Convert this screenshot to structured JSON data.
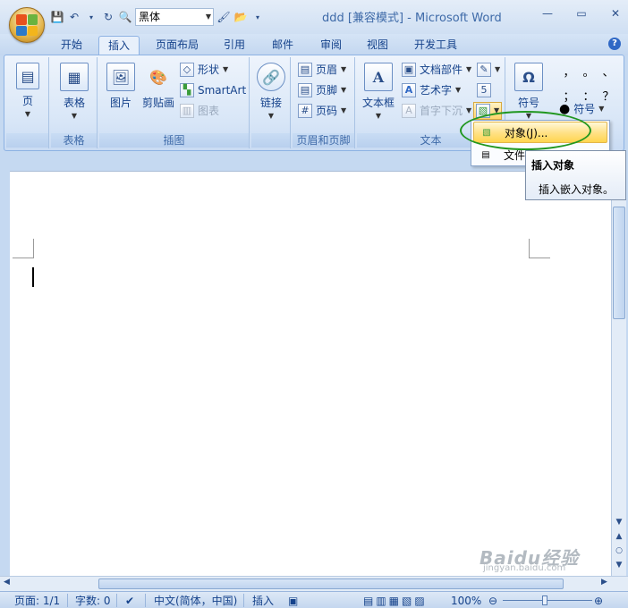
{
  "window": {
    "title": "ddd [兼容模式] - Microsoft Word",
    "controls": [
      "—",
      "▭",
      "✕"
    ]
  },
  "qat": {
    "font_name": "黑体"
  },
  "tabs": [
    "开始",
    "插入",
    "页面布局",
    "引用",
    "邮件",
    "审阅",
    "视图",
    "开发工具"
  ],
  "active_tab": "插入",
  "ribbon": {
    "pages": {
      "button": "页",
      "group": ""
    },
    "tables": {
      "button": "表格",
      "group": "表格"
    },
    "illustrations": {
      "group": "插图",
      "picture": "图片",
      "clipart": "剪贴画",
      "shapes": "形状",
      "smartart": "SmartArt",
      "chart": "图表"
    },
    "links": {
      "button": "链接"
    },
    "header_footer": {
      "group": "页眉和页脚",
      "header": "页眉",
      "footer": "页脚",
      "page_number": "页码"
    },
    "text": {
      "group": "文本",
      "textbox": "文本框",
      "quick_parts": "文档部件",
      "wordart": "艺术字",
      "dropcap": "首字下沉"
    },
    "symbols": {
      "button": "符号",
      "symbol_small": "符号",
      "chars": [
        "，",
        "。",
        "、",
        "；",
        "：",
        "？"
      ]
    }
  },
  "dropdown": {
    "items": [
      {
        "label": "对象(J)...",
        "highlighted": true
      },
      {
        "label": "文件",
        "highlighted": false
      }
    ]
  },
  "tooltip": {
    "title": "插入对象",
    "body": "插入嵌入对象。"
  },
  "statusbar": {
    "page": "页面: 1/1",
    "words": "字数: 0",
    "language": "中文(简体，中国)",
    "mode": "插入",
    "zoom": "100%"
  },
  "watermark": {
    "brand": "Baidu经验",
    "url": "jingyan.baidu.com"
  },
  "colors": {
    "accent": "#15428b",
    "ribbon_bg": "#dbe8f8",
    "highlight": "#ffe28a",
    "ring": "#219720"
  }
}
